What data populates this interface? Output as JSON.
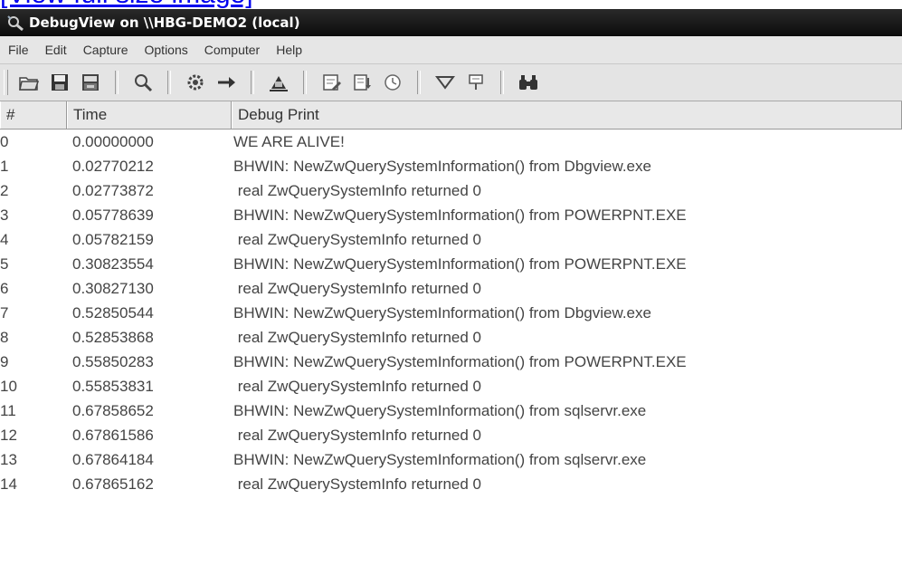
{
  "top_link": "[View full size image]",
  "window": {
    "title": "DebugView on \\\\HBG-DEMO2 (local)"
  },
  "menu": [
    "File",
    "Edit",
    "Capture",
    "Options",
    "Computer",
    "Help"
  ],
  "toolbar": {
    "groups": [
      [
        "open-folder-icon",
        "save-icon",
        "save-as-icon"
      ],
      [
        "find-icon"
      ],
      [
        "capture-gear-icon",
        "forward-arrow-icon"
      ],
      [
        "clear-display-icon"
      ],
      [
        "edit-filter-icon",
        "append-log-icon",
        "clock-icon"
      ],
      [
        "filter-icon",
        "highlight-icon"
      ],
      [
        "binoculars-icon"
      ]
    ]
  },
  "columns": [
    "#",
    "Time",
    "Debug Print"
  ],
  "rows": [
    {
      "num": "0",
      "time": "0.00000000",
      "print": "WE ARE ALIVE!"
    },
    {
      "num": "1",
      "time": "0.02770212",
      "print": "BHWIN: NewZwQuerySystemInformation() from Dbgview.exe"
    },
    {
      "num": "2",
      "time": "0.02773872",
      "print": " real ZwQuerySystemInfo returned 0"
    },
    {
      "num": "3",
      "time": "0.05778639",
      "print": "BHWIN: NewZwQuerySystemInformation() from POWERPNT.EXE"
    },
    {
      "num": "4",
      "time": "0.05782159",
      "print": " real ZwQuerySystemInfo returned 0"
    },
    {
      "num": "5",
      "time": "0.30823554",
      "print": "BHWIN: NewZwQuerySystemInformation() from POWERPNT.EXE"
    },
    {
      "num": "6",
      "time": "0.30827130",
      "print": " real ZwQuerySystemInfo returned 0"
    },
    {
      "num": "7",
      "time": "0.52850544",
      "print": "BHWIN: NewZwQuerySystemInformation() from Dbgview.exe"
    },
    {
      "num": "8",
      "time": "0.52853868",
      "print": " real ZwQuerySystemInfo returned 0"
    },
    {
      "num": "9",
      "time": "0.55850283",
      "print": "BHWIN: NewZwQuerySystemInformation() from POWERPNT.EXE"
    },
    {
      "num": "10",
      "time": "0.55853831",
      "print": " real ZwQuerySystemInfo returned 0"
    },
    {
      "num": "11",
      "time": "0.67858652",
      "print": "BHWIN: NewZwQuerySystemInformation() from sqlservr.exe"
    },
    {
      "num": "12",
      "time": "0.67861586",
      "print": " real ZwQuerySystemInfo returned 0"
    },
    {
      "num": "13",
      "time": "0.67864184",
      "print": "BHWIN: NewZwQuerySystemInformation() from sqlservr.exe"
    },
    {
      "num": "14",
      "time": "0.67865162",
      "print": " real ZwQuerySystemInfo returned 0"
    }
  ]
}
